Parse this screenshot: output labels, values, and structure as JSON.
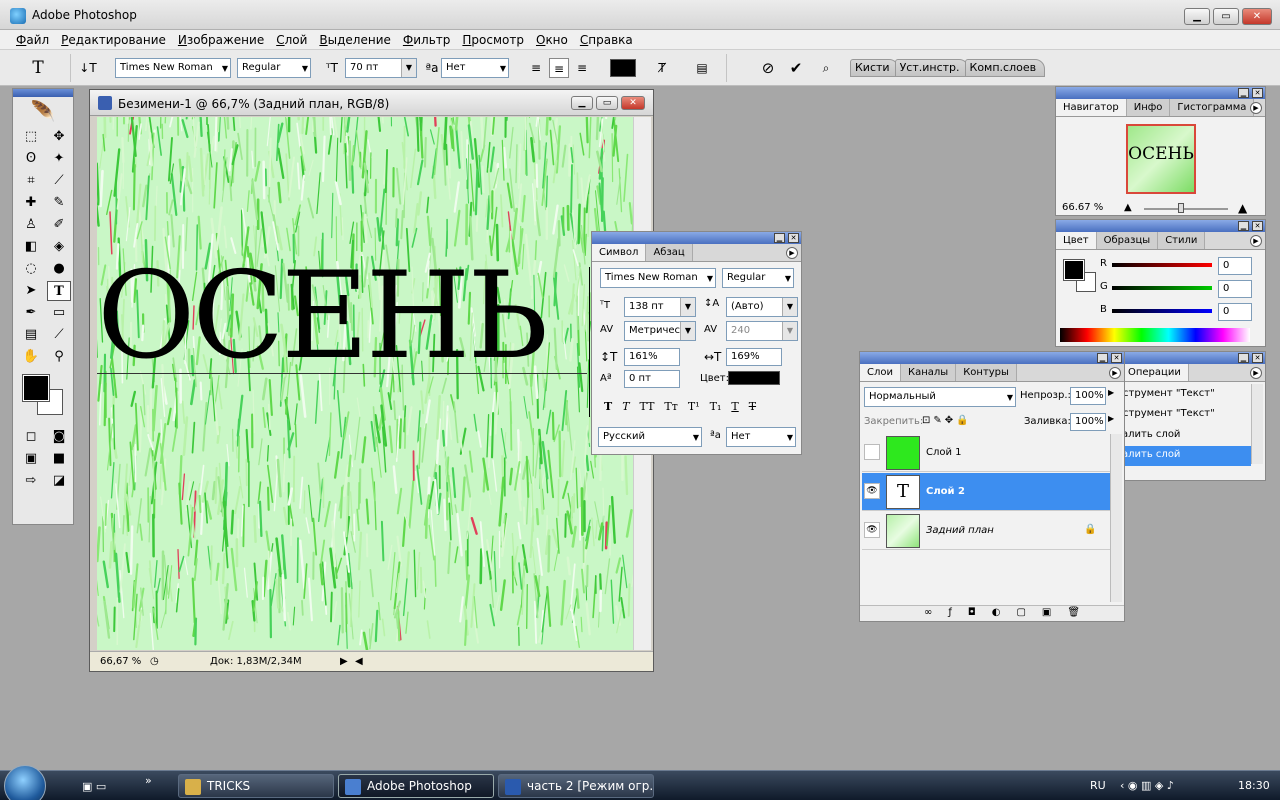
{
  "app": {
    "title": "Adobe Photoshop"
  },
  "menu": [
    "Файл",
    "Редактирование",
    "Изображение",
    "Слой",
    "Выделение",
    "Фильтр",
    "Просмотр",
    "Окно",
    "Справка"
  ],
  "options": {
    "font_family": "Times New Roman",
    "font_style": "Regular",
    "font_size": "70 пт",
    "antialias": "Нет",
    "palette_tabs": [
      "Кисти",
      "Уст.инстр.",
      "Комп.слоев"
    ]
  },
  "document": {
    "title": "Безимени-1 @ 66,7% (Задний план, RGB/8)",
    "canvas_text": "ОСЕНЬ",
    "zoom": "66,67 %",
    "doc_info": "Док: 1,83M/2,34M"
  },
  "navigator": {
    "tabs": [
      "Навигатор",
      "Инфо",
      "Гистограмма"
    ],
    "zoom": "66.67 %",
    "preview_text": "ОСЕНЬ"
  },
  "color": {
    "tabs": [
      "Цвет",
      "Образцы",
      "Стили"
    ],
    "r_label": "R",
    "g_label": "G",
    "b_label": "B",
    "r": "0",
    "g": "0",
    "b": "0"
  },
  "character": {
    "tabs": [
      "Символ",
      "Абзац"
    ],
    "font_family": "Times New Roman",
    "font_style": "Regular",
    "size": "138 пт",
    "leading": "(Авто)",
    "kerning": "Метрическ",
    "tracking": "240",
    "vscale": "161%",
    "hscale": "169%",
    "baseline_shift": "0 пт",
    "color_label": "Цвет:",
    "language": "Русский",
    "antialias": "Нет",
    "style_buttons": [
      "T",
      "T",
      "TT",
      "Tт",
      "T¹",
      "T₁",
      "T",
      "T"
    ]
  },
  "layers": {
    "tabs": [
      "Слои",
      "Каналы",
      "Контуры"
    ],
    "blend_mode": "Нормальный",
    "opacity_label": "Непрозр.:",
    "opacity": "100%",
    "lock_label": "Закрепить:",
    "fill_label": "Заливка:",
    "fill": "100%",
    "items": [
      {
        "name": "Слой 1",
        "visible": false,
        "thumb_color": "#2ee81e"
      },
      {
        "name": "Слой 2",
        "visible": true,
        "thumb_glyph": "T",
        "selected": true
      },
      {
        "name": "Задний план",
        "visible": true,
        "thumb_color": "#b6f0a8"
      }
    ]
  },
  "history": {
    "tab": "Операции",
    "items": [
      "Инструмент \"Текст\"",
      "Инструмент \"Текст\"",
      "Удалить слой",
      "Удалить слой"
    ]
  },
  "taskbar": {
    "tasks": [
      "TRICKS",
      "Adobe Photoshop",
      "часть 2 [Режим огр..."
    ],
    "lang": "RU",
    "clock": "18:30"
  },
  "colors": {
    "accent": "#3d8ef0",
    "grass": "#7ee06a",
    "title_blue": "#4a70c0"
  }
}
